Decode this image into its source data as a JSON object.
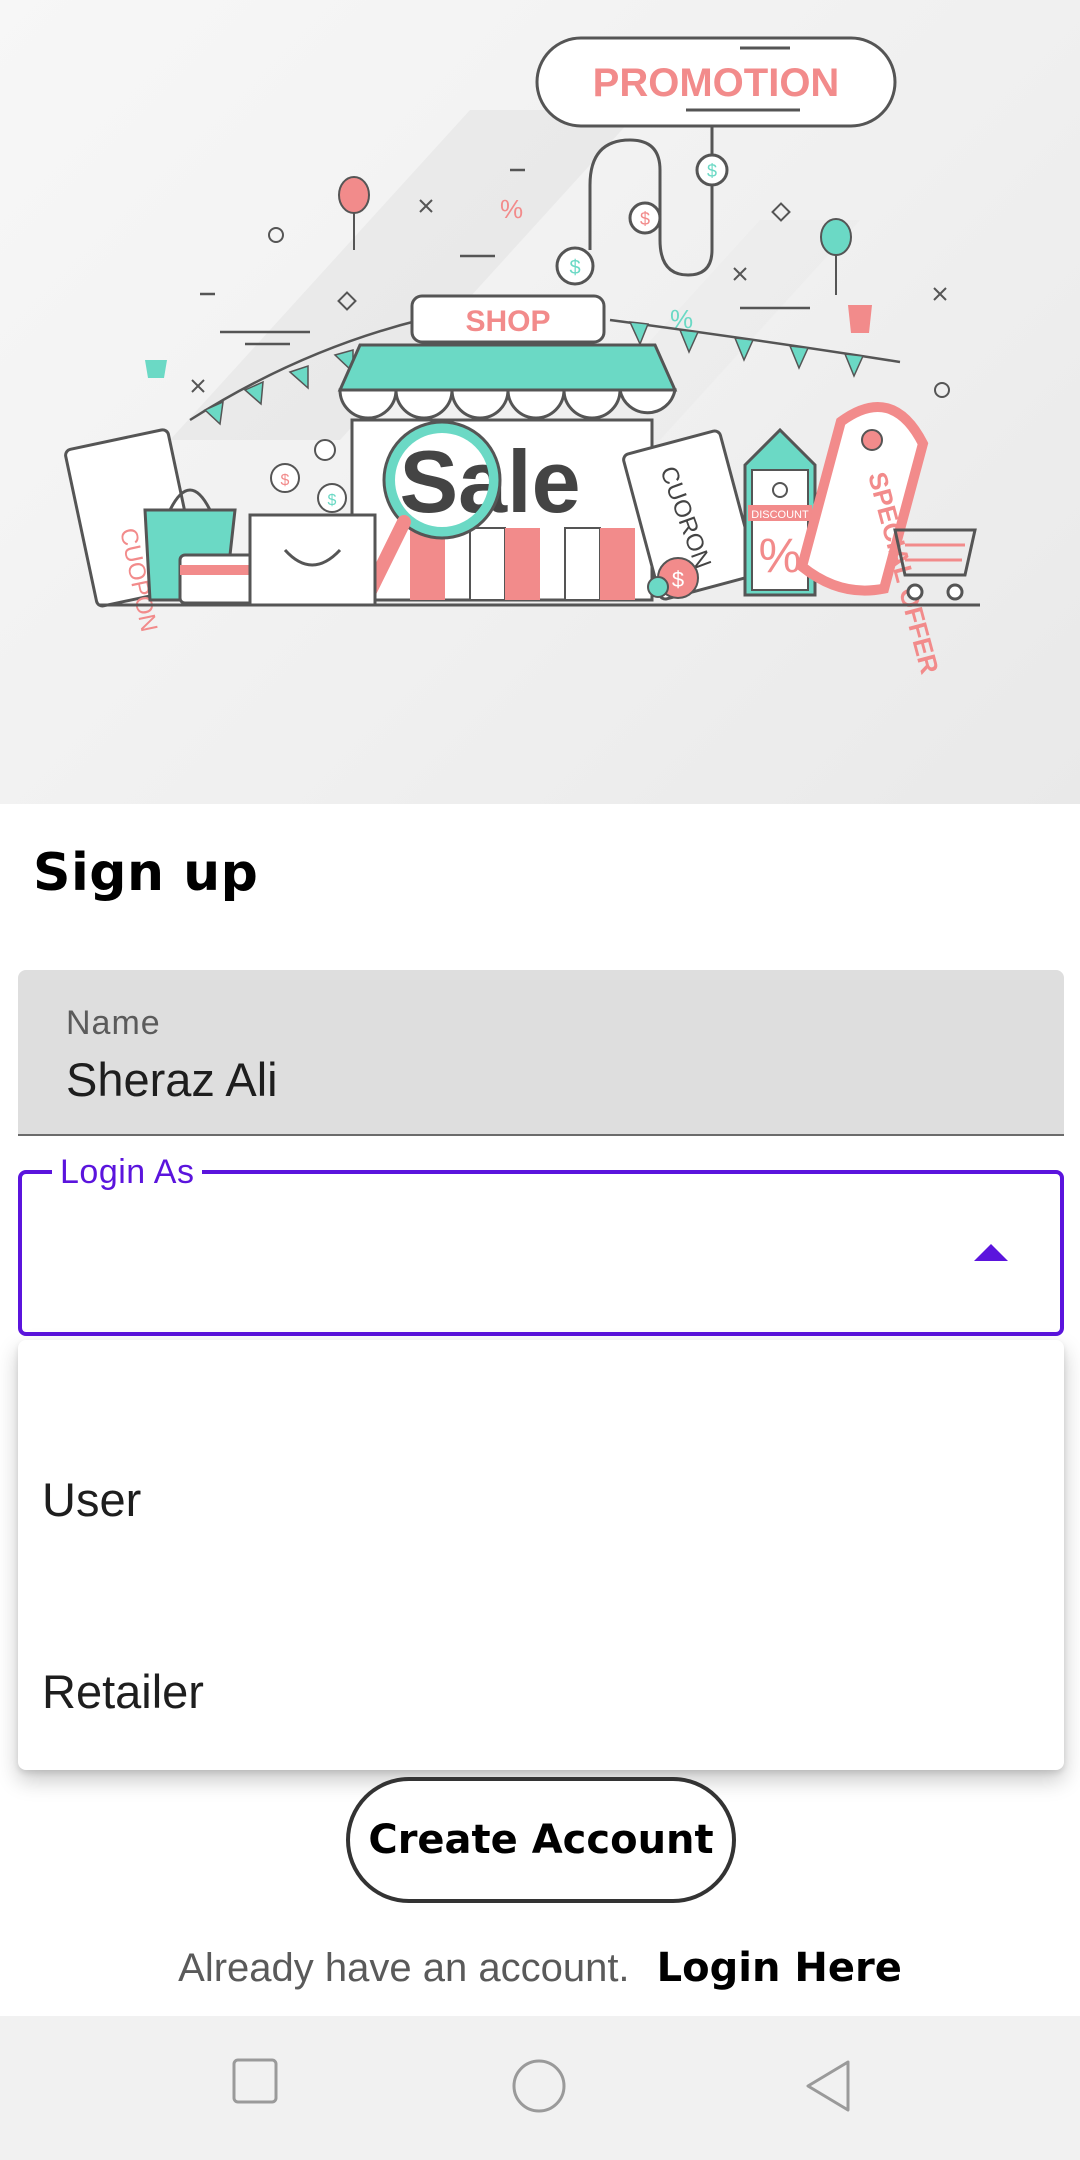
{
  "hero": {
    "image_name": "shop-promotion-illustration",
    "banner_text": "PROMOTION",
    "shop_text": "SHOP",
    "sale_text": "Sale",
    "coupon_text": "CUOPON",
    "coupon_text_2": "CUORON",
    "special_offer_text": "SPECIAL OFFER",
    "discount_text": "DISCOUNT"
  },
  "form": {
    "title": "Sign up",
    "name_label": "Name",
    "name_value": "Sheraz Ali",
    "login_as_label": "Login As",
    "login_as_options": [
      "User",
      "Retailer"
    ],
    "create_account_label": "Create Account",
    "already_text": "Already have an account.",
    "login_link": "Login Here"
  },
  "colors": {
    "accent": "#5b14dd",
    "mint": "#6bd9c5",
    "coral": "#f2898a",
    "navbar": "#f1f1f1"
  },
  "navbar": {
    "icons": [
      "recent-apps-icon",
      "home-icon",
      "back-icon"
    ]
  }
}
